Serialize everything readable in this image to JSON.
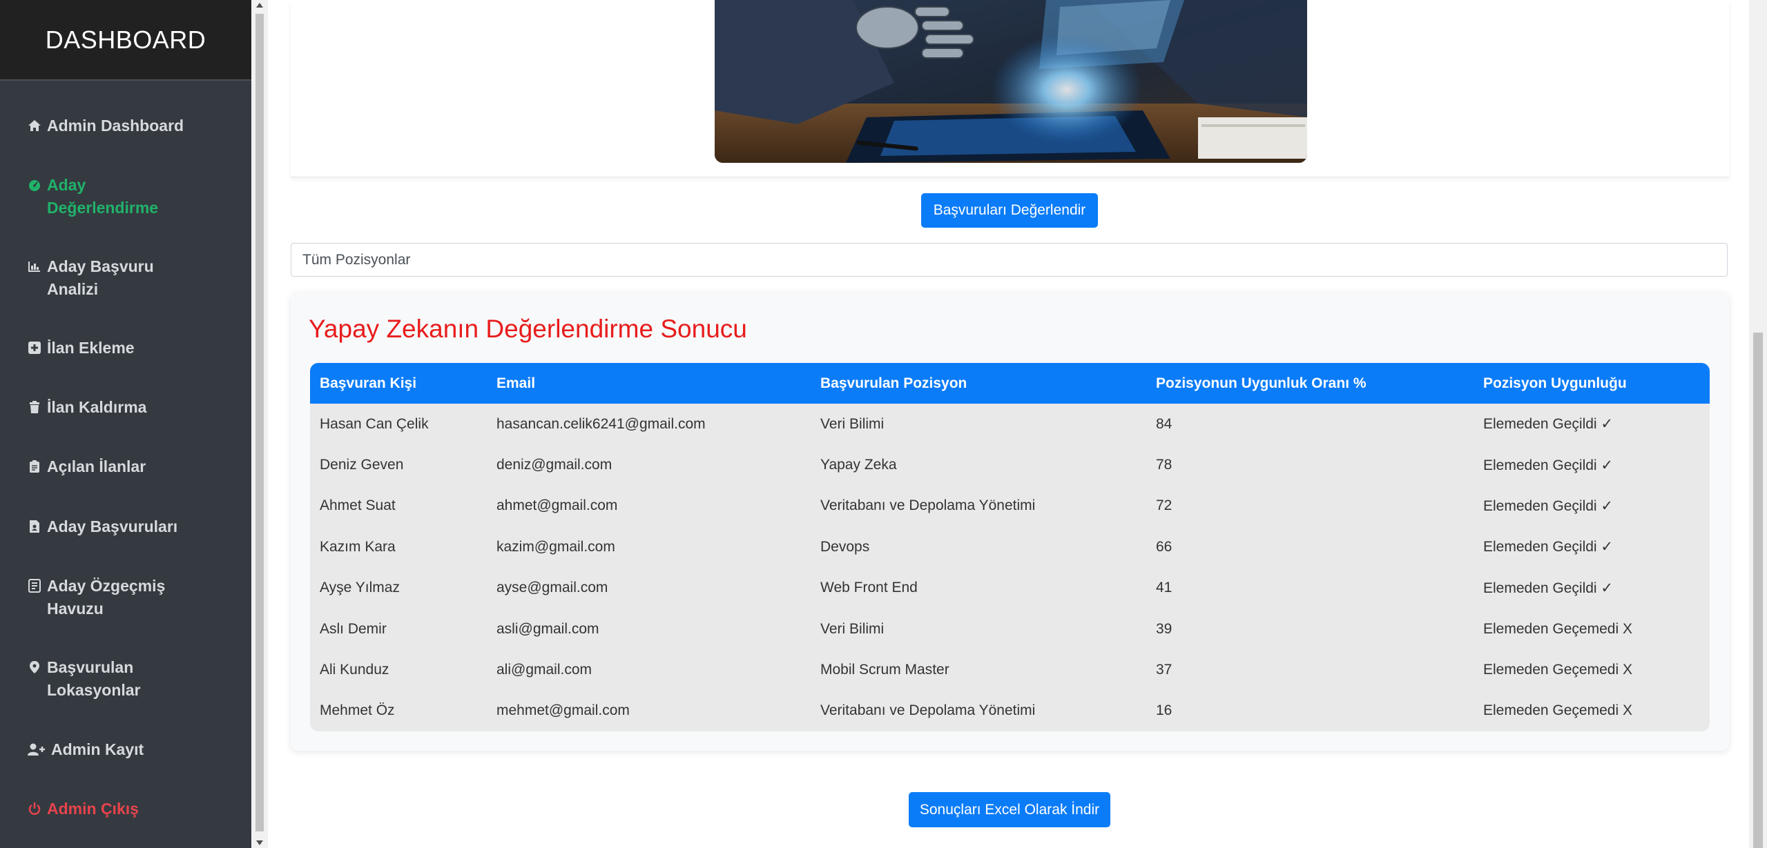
{
  "sidebar": {
    "title": "DASHBOARD",
    "items": [
      {
        "label": "Admin Dashboard",
        "icon": "home-icon"
      },
      {
        "label": "Aday Değerlendirme",
        "icon": "gauge-icon"
      },
      {
        "label": "Aday Başvuru Analizi",
        "icon": "chart-bar-icon"
      },
      {
        "label": "İlan Ekleme",
        "icon": "plus-square-icon"
      },
      {
        "label": "İlan Kaldırma",
        "icon": "trash-icon"
      },
      {
        "label": "Açılan İlanlar",
        "icon": "clipboard-icon"
      },
      {
        "label": "Aday Başvuruları",
        "icon": "file-user-icon"
      },
      {
        "label": "Aday Özgeçmiş Havuzu",
        "icon": "document-icon"
      },
      {
        "label": "Başvurulan Lokasyonlar",
        "icon": "map-pin-icon"
      },
      {
        "label": "Admin Kayıt",
        "icon": "user-plus-icon"
      },
      {
        "label": "Admin Çıkış",
        "icon": "power-icon"
      }
    ],
    "active_index": 1,
    "colors": {
      "background": "#343a40",
      "header": "#212121",
      "active": "#21b26a",
      "logout": "#e8434c"
    }
  },
  "main": {
    "evaluate_button": "Başvuruları Değerlendir",
    "position_filter": {
      "selected": "Tüm Pozisyonlar"
    },
    "results": {
      "title": "Yapay Zekanın Değerlendirme Sonucu",
      "columns": [
        "Başvuran Kişi",
        "Email",
        "Başvurulan Pozisyon",
        "Pozisyonun Uygunluk Oranı %",
        "Pozisyon Uygunluğu"
      ],
      "rows": [
        [
          "Hasan Can Çelik",
          "hasancan.celik6241@gmail.com",
          "Veri Bilimi",
          "84",
          "Elemeden Geçildi ✓"
        ],
        [
          "Deniz Geven",
          "deniz@gmail.com",
          "Yapay Zeka",
          "78",
          "Elemeden Geçildi ✓"
        ],
        [
          "Ahmet Suat",
          "ahmet@gmail.com",
          "Veritabanı ve Depolama Yönetimi",
          "72",
          "Elemeden Geçildi ✓"
        ],
        [
          "Kazım Kara",
          "kazim@gmail.com",
          "Devops",
          "66",
          "Elemeden Geçildi ✓"
        ],
        [
          "Ayşe Yılmaz",
          "ayse@gmail.com",
          "Web Front End",
          "41",
          "Elemeden Geçildi ✓"
        ],
        [
          "Aslı Demir",
          "asli@gmail.com",
          "Veri Bilimi",
          "39",
          "Elemeden Geçemedi X"
        ],
        [
          "Ali Kunduz",
          "ali@gmail.com",
          "Mobil Scrum Master",
          "37",
          "Elemeden Geçemedi X"
        ],
        [
          "Mehmet Öz",
          "mehmet@gmail.com",
          "Veritabanı ve Depolama Yönetimi",
          "16",
          "Elemeden Geçemedi X"
        ]
      ]
    },
    "excel_button": "Sonuçları Excel Olarak İndir",
    "colors": {
      "primary": "#0b7cf8",
      "title": "#e81c1c"
    }
  }
}
